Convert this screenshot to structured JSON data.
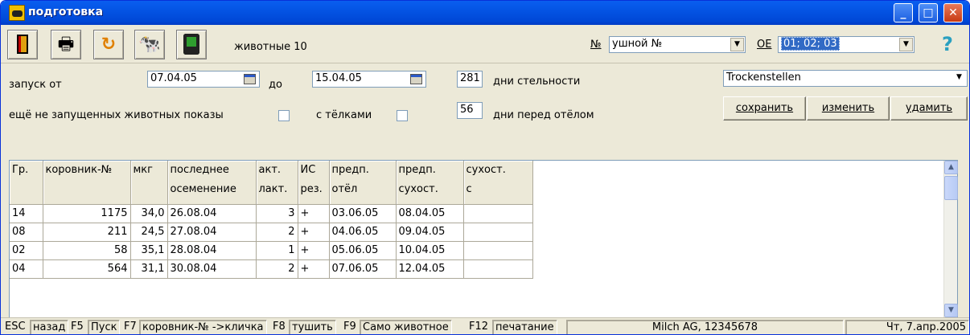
{
  "window": {
    "title": "подготовка",
    "buttons": {
      "minimize": "_",
      "maximize": "□",
      "close": "✕"
    }
  },
  "toolbar": {
    "animal_count_label": "животные 10",
    "ear_label": "№",
    "ear_select_value": "ушной №",
    "oe_label": "ОЕ",
    "oe_select_value": "01; 02; 03",
    "help": "?"
  },
  "filter": {
    "from_label": "запуск от",
    "from_date": "07.04.05",
    "to_label": "до",
    "to_date": "15.04.05",
    "pregnancy_days": "281",
    "pregnancy_label": "дни стельности",
    "not_started_label": "ещё не запущенных животных показы",
    "heifers_label": "с тёлками",
    "days_before": "56",
    "days_before_label": "дни перед отёлом",
    "profile_value": "Trockenstellen",
    "save_label": "сохранить",
    "change_label": "изменить",
    "delete_label": "удамить"
  },
  "table": {
    "headers": [
      [
        "Гр.",
        ""
      ],
      [
        "коровник-№",
        ""
      ],
      [
        "мкг",
        ""
      ],
      [
        "последнее",
        "осеменение"
      ],
      [
        "акт.",
        "лакт."
      ],
      [
        "ИС",
        "рез."
      ],
      [
        "предп.",
        "отёл"
      ],
      [
        "предп.",
        "сухост."
      ],
      [
        "сухост.",
        "с"
      ]
    ],
    "rows": [
      [
        "14",
        "1175",
        "34,0",
        "26.08.04",
        "3",
        "+",
        "03.06.05",
        "08.04.05",
        ""
      ],
      [
        "08",
        "211",
        "24,5",
        "27.08.04",
        "2",
        "+",
        "04.06.05",
        "09.04.05",
        ""
      ],
      [
        "02",
        "58",
        "35,1",
        "28.08.04",
        "1",
        "+",
        "05.06.05",
        "10.04.05",
        ""
      ],
      [
        "04",
        "564",
        "31,1",
        "30.08.04",
        "2",
        "+",
        "07.06.05",
        "12.04.05",
        ""
      ]
    ]
  },
  "status": {
    "k1": "ESC",
    "v1": "назад",
    "k2": "F5",
    "v2": "Пуск",
    "k3": "F7",
    "v3": "коровник-№ ->кличка",
    "k4": "F8",
    "v4": "тушить",
    "k5": "F9",
    "v5": "Само животное",
    "k6": "F12",
    "v6": "печатание",
    "company": "Milch AG, 12345678",
    "date": "Чт, 7.апр.2005"
  }
}
